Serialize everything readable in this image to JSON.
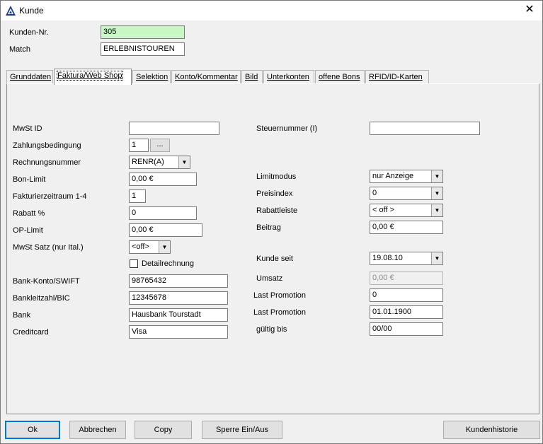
{
  "window": {
    "title": "Kunde"
  },
  "header": {
    "kundennr_label": "Kunden-Nr.",
    "kundennr_value": "305",
    "match_label": "Match",
    "match_value": "ERLEBNISTOUREN"
  },
  "tabs": [
    {
      "label": "Grunddaten"
    },
    {
      "label": "Faktura/Web Shop"
    },
    {
      "label": "Selektion"
    },
    {
      "label": "Konto/Kommentar"
    },
    {
      "label": "Bild"
    },
    {
      "label": "Unterkonten"
    },
    {
      "label": "offene Bons"
    },
    {
      "label": "RFID/ID-Karten"
    }
  ],
  "left": {
    "mwst_id_label": "MwSt ID",
    "mwst_id_value": "",
    "zahlungsbedingung_label": "Zahlungsbedingung",
    "zahlungsbedingung_value": "1",
    "zahlungsbedingung_button": "...",
    "rechnungsnummer_label": "Rechnungsnummer",
    "rechnungsnummer_value": "RENR(A)",
    "bonlimit_label": "Bon-Limit",
    "bonlimit_value": "0,00 €",
    "fakturierzeitraum_label": "Fakturierzeitraum 1-4",
    "fakturierzeitraum_value": "1",
    "rabatt_label": "Rabatt %",
    "rabatt_value": "0",
    "oplimit_label": "OP-Limit",
    "oplimit_value": "0,00 €",
    "mwstsatz_label": "MwSt Satz (nur Ital.)",
    "mwstsatz_value": "<off>",
    "detailrechnung_label": "Detailrechnung",
    "detailrechnung_checked": false,
    "bankkonto_label": "Bank-Konto/SWIFT",
    "bankkonto_value": "98765432",
    "bankleitzahl_label": "Bankleitzahl/BIC",
    "bankleitzahl_value": "12345678",
    "bank_label": "Bank",
    "bank_value": "Hausbank Tourstadt",
    "creditcard_label": "Creditcard",
    "creditcard_value": "Visa"
  },
  "right": {
    "steuernummer_label": "Steuernummer (I)",
    "steuernummer_value": "",
    "limitmodus_label": "Limitmodus",
    "limitmodus_value": "nur Anzeige",
    "preisindex_label": "Preisindex",
    "preisindex_value": "0",
    "rabattleiste_label": "Rabattleiste",
    "rabattleiste_value": "< off >",
    "beitrag_label": "Beitrag",
    "beitrag_value": "0,00 €",
    "kundeseit_label": "Kunde seit",
    "kundeseit_value": "19.08.10",
    "umsatz_label": "Umsatz",
    "umsatz_value": "0,00 €",
    "lastpromo1_label": "Last Promotion",
    "lastpromo1_value": "0",
    "lastpromo2_label": "Last Promotion",
    "lastpromo2_value": "01.01.1900",
    "gueltigbis_label": "gültig bis",
    "gueltigbis_value": "00/00"
  },
  "footer": {
    "ok": "Ok",
    "abbrechen": "Abbrechen",
    "copy": "Copy",
    "sperre": "Sperre Ein/Aus",
    "kundenhistorie": "Kundenhistorie"
  },
  "colors": {
    "kundennr_bg": "#c8f7c5",
    "accent": "#0078d7"
  }
}
